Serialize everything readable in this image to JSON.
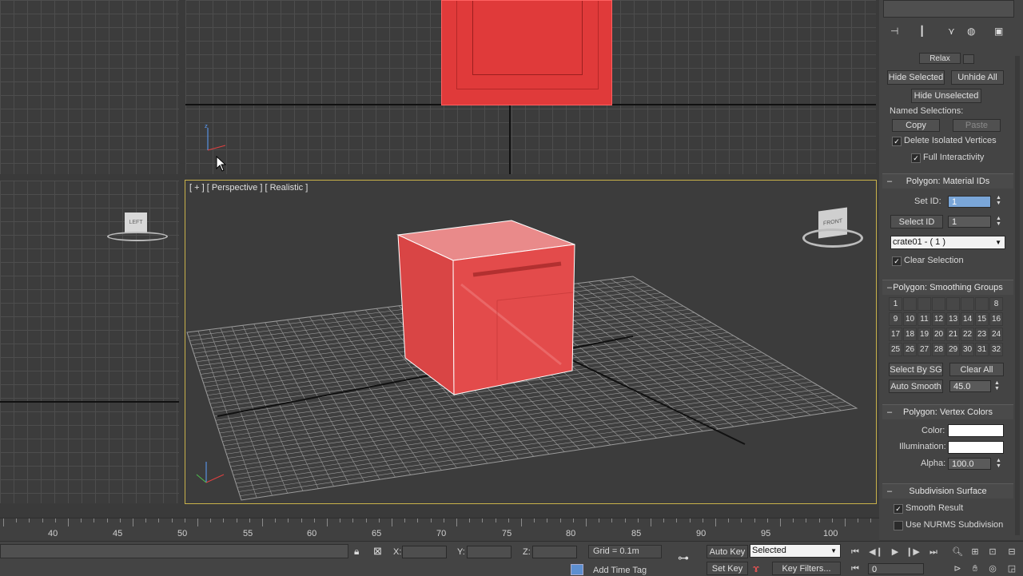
{
  "viewports": {
    "perspective_label": "[ + ] [ Perspective ] [ Realistic ]",
    "left_cube_label": "LEFT",
    "persp_cube_label": "FRONT"
  },
  "panel": {
    "relax_label": "Relax",
    "hide_selected": "Hide Selected",
    "unhide_all": "Unhide All",
    "hide_unselected": "Hide Unselected",
    "named_selections": "Named Selections:",
    "copy": "Copy",
    "paste": "Paste",
    "delete_isolated": "Delete Isolated Vertices",
    "full_interactivity": "Full Interactivity",
    "material_ids_header": "Polygon: Material IDs",
    "set_id_label": "Set ID:",
    "set_id_value": "1",
    "select_id_button": "Select ID",
    "select_id_value": "1",
    "material_dropdown": "crate01 - ( 1 )",
    "clear_selection": "Clear Selection",
    "smoothing_header": "Polygon: Smoothing Groups",
    "smoothing_groups": [
      "1",
      "",
      "",
      "",
      "",
      "",
      "",
      "8",
      "9",
      "10",
      "11",
      "12",
      "13",
      "14",
      "15",
      "16",
      "17",
      "18",
      "19",
      "20",
      "21",
      "22",
      "23",
      "24",
      "25",
      "26",
      "27",
      "28",
      "29",
      "30",
      "31",
      "32"
    ],
    "select_by_sg": "Select By SG",
    "clear_all": "Clear All",
    "auto_smooth": "Auto Smooth",
    "auto_smooth_value": "45.0",
    "vertex_colors_header": "Polygon: Vertex Colors",
    "color_label": "Color:",
    "illumination_label": "Illumination:",
    "alpha_label": "Alpha:",
    "alpha_value": "100.0",
    "subdivision_header": "Subdivision Surface",
    "smooth_result": "Smooth Result",
    "use_nurms": "Use NURMS Subdivision"
  },
  "timeline": {
    "ticks": [
      "40",
      "45",
      "50",
      "55",
      "60",
      "65",
      "70",
      "75",
      "80",
      "85",
      "90",
      "95",
      "100"
    ]
  },
  "status": {
    "x_label": "X:",
    "y_label": "Y:",
    "z_label": "Z:",
    "grid": "Grid = 0.1m",
    "add_time_tag": "Add Time Tag",
    "auto_key": "Auto Key",
    "selected": "Selected",
    "set_key": "Set Key",
    "key_filters": "Key Filters...",
    "frame_value": "0"
  },
  "colors": {
    "accent_red": "#e03c3c",
    "viewport_border": "#c9b24a"
  }
}
